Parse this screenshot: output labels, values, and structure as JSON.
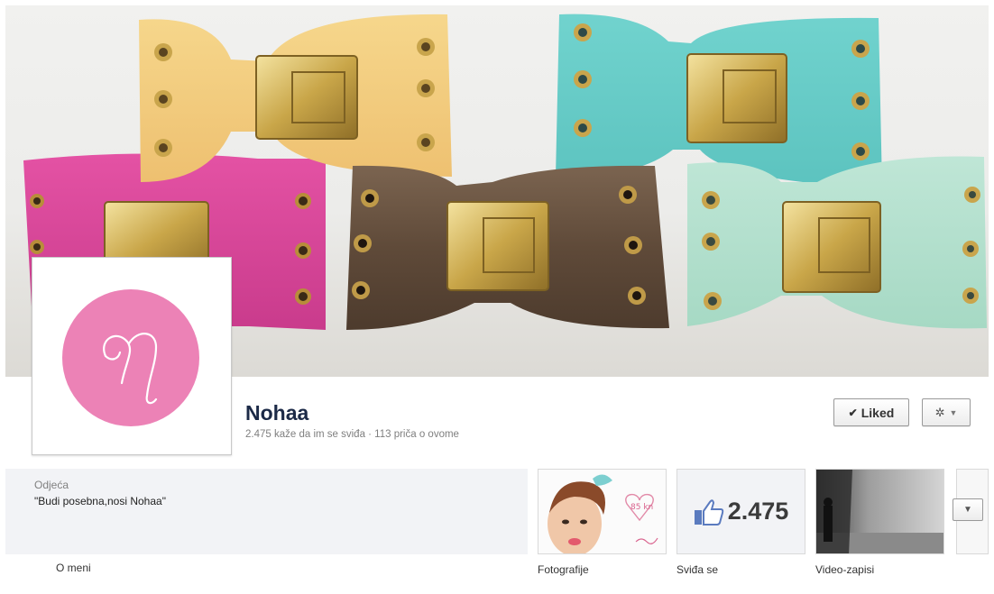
{
  "page": {
    "name": "Nohaa",
    "stats": "2.475 kaže da im se sviđa · 113 priča o ovome"
  },
  "actions": {
    "liked_label": "Liked",
    "check_icon": "✔",
    "gear_icon": "✲",
    "caret_icon": "▼"
  },
  "about": {
    "category": "Odjeća",
    "quote": "\"Budi posebna,nosi Nohaa\"",
    "link_label": "O meni"
  },
  "apps": {
    "photos_label": "Fotografije",
    "likes_label": "Sviđa se",
    "likes_count": "2.475",
    "videos_label": "Video-zapisi",
    "photo_note": "85 kn"
  },
  "colors": {
    "logo_pink": "#ec82b6",
    "page_name": "#1c2a47",
    "like_blue": "#5b7bbf"
  }
}
